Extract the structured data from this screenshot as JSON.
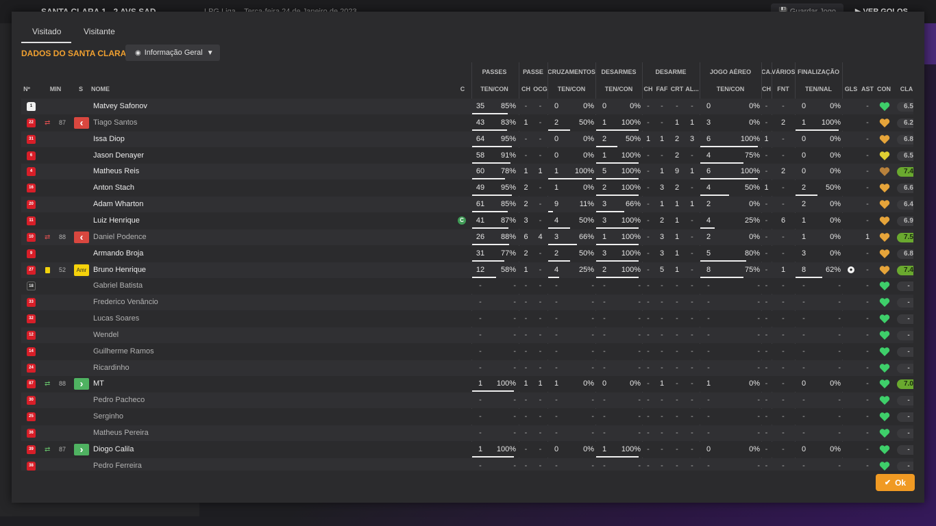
{
  "topbar": {
    "match": "SANTA CLARA  1 - 2  AVS SAD",
    "competition": "LPG Liga",
    "date": "Terça-feira 24 de Janeiro de 2023",
    "save_label": "Guardar Jogo",
    "goals_label": "VER GOLOS"
  },
  "tabs": [
    {
      "label": "Visitado",
      "active": true
    },
    {
      "label": "Visitante",
      "active": false
    }
  ],
  "section_title": "DADOS DO SANTA CLARA",
  "view_dropdown": {
    "label": "Informação Geral",
    "icon": "eye-icon"
  },
  "group_headers": [
    {
      "label": "PASSES"
    },
    {
      "label": "PASSE"
    },
    {
      "label": "CRUZAMENTOS"
    },
    {
      "label": "DESARMES"
    },
    {
      "label": "DESARME"
    },
    {
      "label": "JOGO AÉREO"
    },
    {
      "label": "CA..."
    },
    {
      "label": "VÁRIOS"
    },
    {
      "label": "FINALIZAÇÃO"
    }
  ],
  "col_headers": {
    "num": "Nº",
    "min": "MIN",
    "s": "S",
    "name": "NOME",
    "c": "C",
    "pas_tc": "TEN/CON",
    "pas_ch": "CH",
    "pas_ocg": "OCG",
    "cru_tc": "TEN/CON",
    "des_tc": "TEN/CON",
    "dsm_ch": "CH",
    "dsm_faf": "FAF",
    "dsm_crt": "CRT",
    "dsm_al": "AL...",
    "aer_tc": "TEN/CON",
    "ca_ch": "CH",
    "var_fnt": "FNT",
    "fin_tn": "TEN/NAL",
    "gls": "GLS",
    "ast": "AST",
    "con": "CON",
    "cla": "CLA"
  },
  "colors": {
    "accent": "#f0a030",
    "ok": "#f09a23",
    "sub_out": "#d9473f",
    "sub_in": "#4fb261",
    "rating_good": "#6aa92f"
  },
  "players": [
    {
      "num": "1",
      "shirt": "gk",
      "name": "Matvey Safonov",
      "played": true,
      "p": [
        "35",
        "85%"
      ],
      "pf": 0.85,
      "pch": "-",
      "pocg": "-",
      "c": [
        "0",
        "0%"
      ],
      "cf": 0,
      "d": [
        "0",
        "0%"
      ],
      "df": 0,
      "ch": "-",
      "faf": "-",
      "crt": "-",
      "al": "-",
      "a": [
        "0",
        "0%"
      ],
      "af": 0,
      "cach": "-",
      "fnt": "-",
      "f": [
        "0",
        "0%"
      ],
      "ff": 0,
      "gls": "",
      "ast": "-",
      "con": "green",
      "cla": "6.5"
    },
    {
      "num": "22",
      "shirt": "field",
      "sub": "out",
      "min": "87",
      "badge": "out",
      "name": "Tiago Santos",
      "played": true,
      "unused": true,
      "p": [
        "43",
        "83%"
      ],
      "pf": 0.83,
      "pch": "1",
      "pocg": "-",
      "c": [
        "2",
        "50%"
      ],
      "cf": 0.5,
      "d": [
        "1",
        "100%"
      ],
      "df": 1,
      "ch": "-",
      "faf": "-",
      "crt": "1",
      "al": "1",
      "a": [
        "3",
        "0%"
      ],
      "af": 0,
      "cach": "-",
      "fnt": "2",
      "f": [
        "1",
        "100%"
      ],
      "ff": 1,
      "gls": "",
      "ast": "-",
      "con": "orange",
      "cla": "6.2"
    },
    {
      "num": "31",
      "shirt": "field",
      "name": "Issa Diop",
      "played": true,
      "p": [
        "64",
        "95%"
      ],
      "pf": 0.95,
      "pch": "-",
      "pocg": "-",
      "c": [
        "0",
        "0%"
      ],
      "cf": 0,
      "d": [
        "2",
        "50%"
      ],
      "df": 0.5,
      "ch": "1",
      "faf": "1",
      "crt": "2",
      "al": "3",
      "a": [
        "6",
        "100%"
      ],
      "af": 1,
      "cach": "1",
      "fnt": "-",
      "f": [
        "0",
        "0%"
      ],
      "ff": 0,
      "gls": "",
      "ast": "-",
      "con": "orange",
      "cla": "6.8"
    },
    {
      "num": "6",
      "shirt": "field",
      "name": "Jason Denayer",
      "played": true,
      "p": [
        "58",
        "91%"
      ],
      "pf": 0.91,
      "pch": "-",
      "pocg": "-",
      "c": [
        "0",
        "0%"
      ],
      "cf": 0,
      "d": [
        "1",
        "100%"
      ],
      "df": 1,
      "ch": "-",
      "faf": "-",
      "crt": "2",
      "al": "-",
      "a": [
        "4",
        "75%"
      ],
      "af": 0.75,
      "cach": "-",
      "fnt": "-",
      "f": [
        "0",
        "0%"
      ],
      "ff": 0,
      "gls": "",
      "ast": "-",
      "con": "yellow",
      "cla": "6.5"
    },
    {
      "num": "4",
      "shirt": "field",
      "name": "Matheus Reis",
      "played": true,
      "p": [
        "60",
        "78%"
      ],
      "pf": 0.78,
      "pch": "1",
      "pocg": "1",
      "c": [
        "1",
        "100%"
      ],
      "cf": 1,
      "d": [
        "5",
        "100%"
      ],
      "df": 1,
      "ch": "-",
      "faf": "1",
      "crt": "9",
      "al": "1",
      "a": [
        "6",
        "100%"
      ],
      "af": 1,
      "cach": "-",
      "fnt": "2",
      "f": [
        "0",
        "0%"
      ],
      "ff": 0,
      "gls": "",
      "ast": "-",
      "con": "brown",
      "cla": "7.4",
      "good": true
    },
    {
      "num": "16",
      "shirt": "field",
      "name": "Anton Stach",
      "played": true,
      "p": [
        "49",
        "95%"
      ],
      "pf": 0.95,
      "pch": "2",
      "pocg": "-",
      "c": [
        "1",
        "0%"
      ],
      "cf": 0,
      "d": [
        "2",
        "100%"
      ],
      "df": 1,
      "ch": "-",
      "faf": "3",
      "crt": "2",
      "al": "-",
      "a": [
        "4",
        "50%"
      ],
      "af": 0.5,
      "cach": "1",
      "fnt": "-",
      "f": [
        "2",
        "50%"
      ],
      "ff": 0.5,
      "gls": "",
      "ast": "-",
      "con": "orange",
      "cla": "6.6"
    },
    {
      "num": "20",
      "shirt": "field",
      "name": "Adam Wharton",
      "played": true,
      "p": [
        "61",
        "85%"
      ],
      "pf": 0.85,
      "pch": "2",
      "pocg": "-",
      "c": [
        "9",
        "11%"
      ],
      "cf": 0.11,
      "d": [
        "3",
        "66%"
      ],
      "df": 0.66,
      "ch": "-",
      "faf": "1",
      "crt": "1",
      "al": "1",
      "a": [
        "2",
        "0%"
      ],
      "af": 0,
      "cach": "-",
      "fnt": "-",
      "f": [
        "2",
        "0%"
      ],
      "ff": 0,
      "gls": "",
      "ast": "-",
      "con": "orange",
      "cla": "6.4"
    },
    {
      "num": "11",
      "shirt": "field",
      "name": "Luiz Henrique",
      "played": true,
      "captain": true,
      "p": [
        "41",
        "87%"
      ],
      "pf": 0.87,
      "pch": "3",
      "pocg": "-",
      "c": [
        "4",
        "50%"
      ],
      "cf": 0.5,
      "d": [
        "3",
        "100%"
      ],
      "df": 1,
      "ch": "-",
      "faf": "2",
      "crt": "1",
      "al": "-",
      "a": [
        "4",
        "25%"
      ],
      "af": 0.25,
      "cach": "-",
      "fnt": "6",
      "f": [
        "1",
        "0%"
      ],
      "ff": 0,
      "gls": "",
      "ast": "-",
      "con": "orange",
      "cla": "6.9"
    },
    {
      "num": "10",
      "shirt": "field",
      "sub": "out",
      "min": "88",
      "badge": "out",
      "name": "Daniel Podence",
      "played": true,
      "unused": true,
      "p": [
        "26",
        "88%"
      ],
      "pf": 0.88,
      "pch": "6",
      "pocg": "4",
      "c": [
        "3",
        "66%"
      ],
      "cf": 0.66,
      "d": [
        "1",
        "100%"
      ],
      "df": 1,
      "ch": "-",
      "faf": "3",
      "crt": "1",
      "al": "-",
      "a": [
        "2",
        "0%"
      ],
      "af": 0,
      "cach": "-",
      "fnt": "-",
      "f": [
        "1",
        "0%"
      ],
      "ff": 0,
      "gls": "",
      "ast": "1",
      "con": "orange",
      "cla": "7.5",
      "good": true
    },
    {
      "num": "9",
      "shirt": "field",
      "name": "Armando Broja",
      "played": true,
      "p": [
        "31",
        "77%"
      ],
      "pf": 0.77,
      "pch": "2",
      "pocg": "-",
      "c": [
        "2",
        "50%"
      ],
      "cf": 0.5,
      "d": [
        "3",
        "100%"
      ],
      "df": 1,
      "ch": "-",
      "faf": "3",
      "crt": "1",
      "al": "-",
      "a": [
        "5",
        "80%"
      ],
      "af": 0.8,
      "cach": "-",
      "fnt": "-",
      "f": [
        "3",
        "0%"
      ],
      "ff": 0,
      "gls": "",
      "ast": "-",
      "con": "orange",
      "cla": "6.8"
    },
    {
      "num": "27",
      "shirt": "field",
      "card": true,
      "min": "52",
      "badge": "pos",
      "badge_text": "Amr",
      "name": "Bruno Henrique",
      "played": true,
      "p": [
        "12",
        "58%"
      ],
      "pf": 0.58,
      "pch": "1",
      "pocg": "-",
      "c": [
        "4",
        "25%"
      ],
      "cf": 0.25,
      "d": [
        "2",
        "100%"
      ],
      "df": 1,
      "ch": "-",
      "faf": "5",
      "crt": "1",
      "al": "-",
      "a": [
        "8",
        "75%"
      ],
      "af": 0.75,
      "cach": "-",
      "fnt": "1",
      "f": [
        "8",
        "62%"
      ],
      "ff": 0.62,
      "gls": "ball",
      "ast": "-",
      "con": "orange",
      "cla": "7.4",
      "good": true
    },
    {
      "num": "18",
      "shirt": "gk2",
      "name": "Gabriel Batista",
      "played": false,
      "con": "green",
      "cla": "-"
    },
    {
      "num": "33",
      "shirt": "field",
      "name": "Frederico Venâncio",
      "played": false,
      "con": "green",
      "cla": "-"
    },
    {
      "num": "32",
      "shirt": "field",
      "name": "Lucas Soares",
      "played": false,
      "con": "green",
      "cla": "-"
    },
    {
      "num": "12",
      "shirt": "field",
      "name": "Wendel",
      "played": false,
      "con": "green",
      "cla": "-"
    },
    {
      "num": "14",
      "shirt": "field",
      "name": "Guilherme Ramos",
      "played": false,
      "con": "green",
      "cla": "-"
    },
    {
      "num": "24",
      "shirt": "field",
      "name": "Ricardinho",
      "played": false,
      "con": "green",
      "cla": "-"
    },
    {
      "num": "87",
      "shirt": "field",
      "sub": "in",
      "min": "88",
      "badge": "in",
      "name": "MT",
      "played": true,
      "p": [
        "1",
        "100%"
      ],
      "pf": 1,
      "pch": "1",
      "pocg": "1",
      "c": [
        "1",
        "0%"
      ],
      "cf": 0,
      "d": [
        "0",
        "0%"
      ],
      "df": 0,
      "ch": "-",
      "faf": "1",
      "crt": "-",
      "al": "-",
      "a": [
        "1",
        "0%"
      ],
      "af": 0,
      "cach": "-",
      "fnt": "-",
      "f": [
        "0",
        "0%"
      ],
      "ff": 0,
      "gls": "",
      "ast": "-",
      "con": "green",
      "cla": "7.0",
      "good": true
    },
    {
      "num": "30",
      "shirt": "field",
      "name": "Pedro Pacheco",
      "played": false,
      "con": "green",
      "cla": "-"
    },
    {
      "num": "25",
      "shirt": "field",
      "name": "Serginho",
      "played": false,
      "con": "green",
      "cla": "-"
    },
    {
      "num": "36",
      "shirt": "field",
      "name": "Matheus Pereira",
      "played": false,
      "con": "green",
      "cla": "-"
    },
    {
      "num": "39",
      "shirt": "field",
      "sub": "in",
      "min": "87",
      "badge": "in",
      "name": "Diogo Calila",
      "played": true,
      "p": [
        "1",
        "100%"
      ],
      "pf": 1,
      "pch": "-",
      "pocg": "-",
      "c": [
        "0",
        "0%"
      ],
      "cf": 0,
      "d": [
        "1",
        "100%"
      ],
      "df": 1,
      "ch": "-",
      "faf": "-",
      "crt": "-",
      "al": "-",
      "a": [
        "0",
        "0%"
      ],
      "af": 0,
      "cach": "-",
      "fnt": "-",
      "f": [
        "0",
        "0%"
      ],
      "ff": 0,
      "gls": "",
      "ast": "-",
      "con": "green",
      "cla": "-"
    },
    {
      "num": "38",
      "shirt": "field",
      "name": "Pedro Ferreira",
      "played": false,
      "con": "green",
      "cla": "-"
    }
  ],
  "ok_label": "Ok"
}
